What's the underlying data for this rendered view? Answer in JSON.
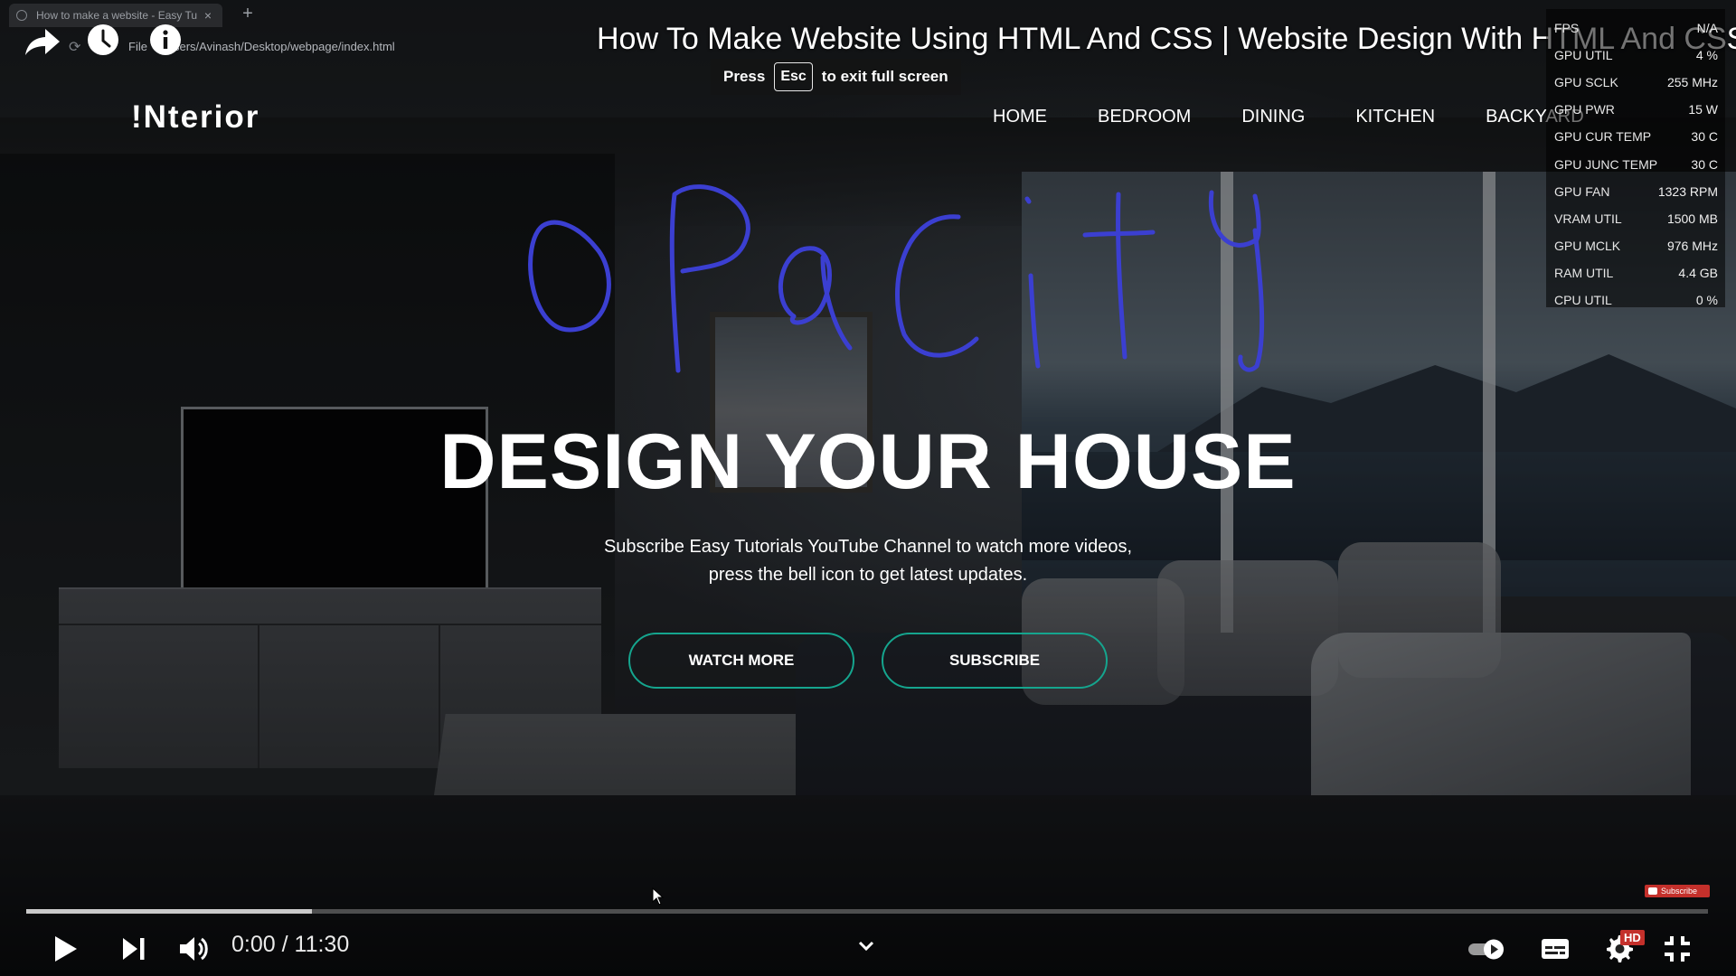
{
  "browser": {
    "tab_title": "How to make a website - Easy Tu",
    "tab_close": "×",
    "new_tab": "+",
    "url_scheme": "File",
    "url_path": "Users/Avinash/Desktop/webpage/index.html"
  },
  "youtube": {
    "video_title": "How To Make Website Using HTML And CSS | Website Design With HTML And CSS",
    "esc_hint_before": "Press",
    "esc_key": "Esc",
    "esc_hint_after": "to exit full screen",
    "current_time": "0:00",
    "time_separator": "/",
    "duration": "11:30",
    "progress_buffered_fraction": 0.17,
    "subscribe_watermark": "Subscribe",
    "hd_badge": "HD",
    "accent_color": "#c4302b"
  },
  "site": {
    "logo": "!Nterior",
    "nav": [
      "HOME",
      "BEDROOM",
      "DINING",
      "KITCHEN",
      "BACKYARD"
    ],
    "hero_title": "DESIGN YOUR HOUSE",
    "hero_subtitle_line1": "Subscribe Easy Tutorials YouTube Channel to watch more videos,",
    "hero_subtitle_line2": "press the bell icon to get latest updates.",
    "button_watch": "WATCH MORE",
    "button_subscribe": "SUBSCRIBE",
    "button_border_color": "#15a58e"
  },
  "annotation": {
    "handwritten_text": "oPacity",
    "ink_color": "#3b3fd1"
  },
  "stats": [
    {
      "label": "FPS",
      "value": "N/A"
    },
    {
      "label": "GPU UTIL",
      "value": "4 %"
    },
    {
      "label": "GPU SCLK",
      "value": "255 MHz"
    },
    {
      "label": "GPU PWR",
      "value": "15 W"
    },
    {
      "label": "GPU CUR TEMP",
      "value": "30 C"
    },
    {
      "label": "GPU JUNC TEMP",
      "value": "30 C"
    },
    {
      "label": "GPU FAN",
      "value": "1323 RPM"
    },
    {
      "label": "VRAM UTIL",
      "value": "1500 MB"
    },
    {
      "label": "GPU MCLK",
      "value": "976 MHz"
    },
    {
      "label": "RAM UTIL",
      "value": "4.4 GB"
    },
    {
      "label": "CPU UTIL",
      "value": "0 %"
    }
  ],
  "icons": {
    "share": "share-icon",
    "watch_later": "clock-icon",
    "info": "info-icon",
    "play": "play-icon",
    "next": "next-icon",
    "volume": "volume-icon",
    "chevron": "chevron-down-icon",
    "autoplay": "autoplay-toggle-icon",
    "captions": "captions-icon",
    "settings": "settings-icon",
    "fullscreen_exit": "fullscreen-exit-icon"
  }
}
